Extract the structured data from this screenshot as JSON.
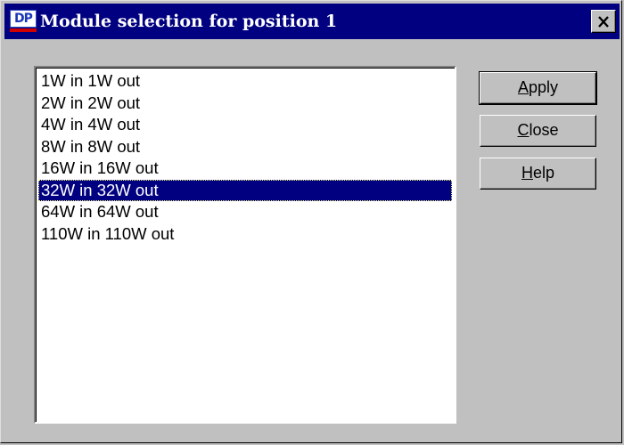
{
  "window": {
    "title": "Module selection for position 1",
    "icon": "dp-app-icon",
    "icon_text": "DP",
    "close_icon": "close-icon"
  },
  "modules": {
    "items": [
      "1W in 1W out",
      "2W in 2W out",
      "4W in 4W out",
      "8W in 8W out",
      "16W in 16W out",
      "32W in 32W out",
      "64W in 64W out",
      "110W in 110W out"
    ],
    "selected": "32W in 32W out"
  },
  "buttons": {
    "apply": {
      "mnemonic": "A",
      "rest": "pply"
    },
    "close": {
      "mnemonic": "C",
      "rest": "lose"
    },
    "help": {
      "mnemonic": "H",
      "rest": "elp"
    }
  },
  "colors": {
    "titlebar": "#000080",
    "selection": "#000080",
    "face": "#c0c0c0"
  }
}
